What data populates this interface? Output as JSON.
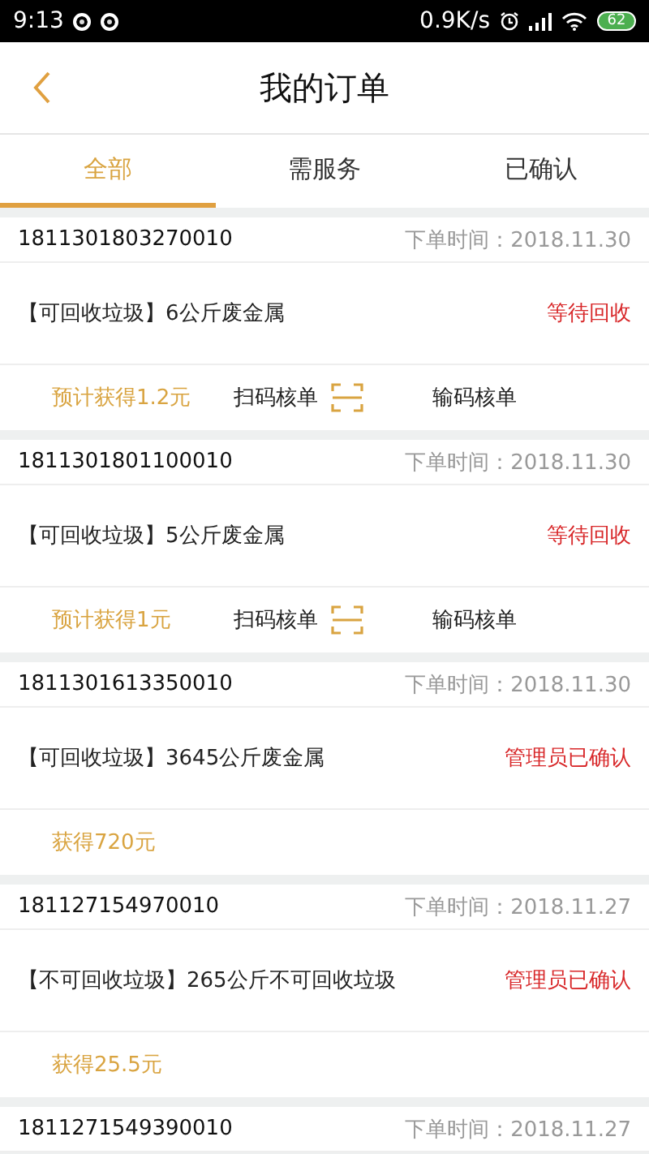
{
  "status_bar": {
    "time": "9:13",
    "network_speed": "0.9K/s",
    "battery": "62"
  },
  "header": {
    "title": "我的订单"
  },
  "tabs": [
    {
      "label": "全部",
      "selected": true
    },
    {
      "label": "需服务",
      "selected": false
    },
    {
      "label": "已确认",
      "selected": false
    }
  ],
  "orders": [
    {
      "kind": "pending",
      "number": "1811301803270010",
      "time": "下单时间：2018.11.30",
      "item": "【可回收垃圾】6公斤废金属",
      "status": "等待回收",
      "earnings": "预计获得1.2元",
      "scan_action": "扫码核单",
      "input_action": "输码核单"
    },
    {
      "kind": "pending",
      "number": "1811301801100010",
      "time": "下单时间：2018.11.30",
      "item": "【可回收垃圾】5公斤废金属",
      "status": "等待回收",
      "earnings": "预计获得1元",
      "scan_action": "扫码核单",
      "input_action": "输码核单"
    },
    {
      "kind": "confirmed",
      "number": "1811301613350010",
      "time": "下单时间：2018.11.30",
      "item": "【可回收垃圾】3645公斤废金属",
      "status": "管理员已确认",
      "earnings": "获得720元"
    },
    {
      "kind": "confirmed",
      "number": "181127154970010",
      "time": "下单时间：2018.11.27",
      "item": "【不可回收垃圾】265公斤不可回收垃圾",
      "status": "管理员已确认",
      "earnings": "获得25.5元"
    },
    {
      "kind": "partial",
      "number": "1811271549390010",
      "time": "下单时间：2018.11.27"
    }
  ]
}
